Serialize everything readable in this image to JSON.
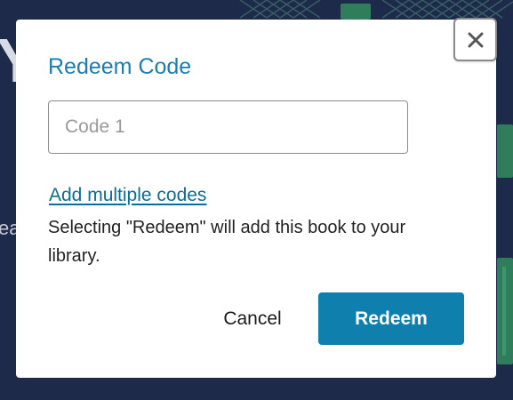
{
  "background": {
    "heading_fragment": "Yo",
    "text_fragment": "ea",
    "colors": {
      "page_bg": "#1e2a4a",
      "book_green": "#2f7d5a"
    }
  },
  "modal": {
    "title": "Redeem Code",
    "close_icon": "close-icon",
    "code_input": {
      "value": "",
      "placeholder": "Code 1"
    },
    "add_multiple_link": "Add multiple codes",
    "info_text": "Selecting \"Redeem\" will add this book to your library.",
    "cancel_label": "Cancel",
    "redeem_label": "Redeem",
    "colors": {
      "accent": "#0f7fae",
      "title": "#1a7fae",
      "link": "#0d6d96"
    }
  }
}
